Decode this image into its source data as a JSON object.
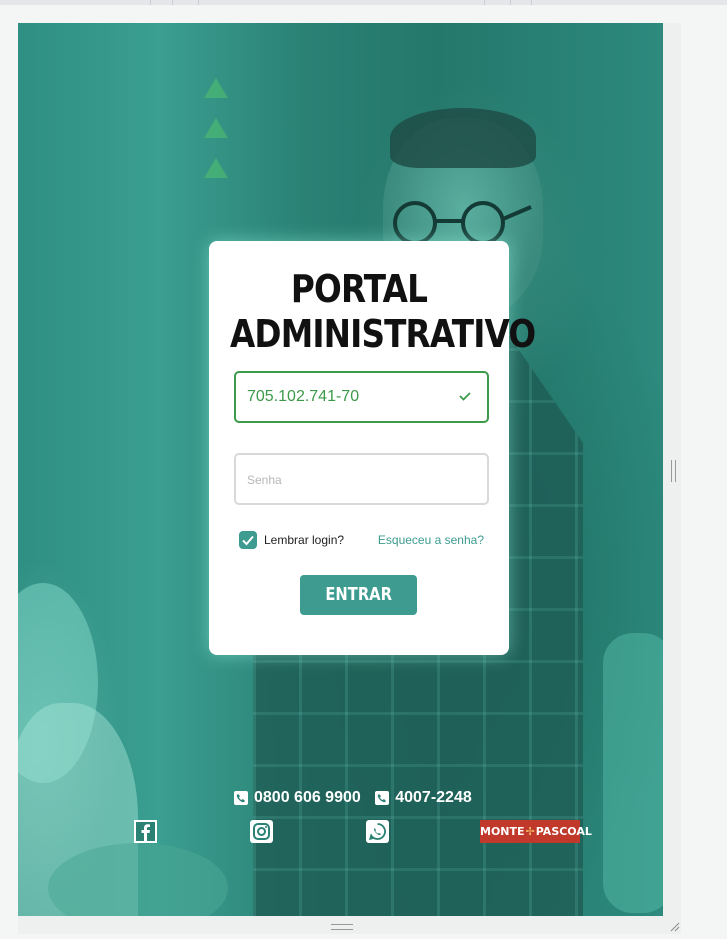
{
  "card": {
    "title_line1": "PORTAL",
    "title_line2": "ADMINISTRATIVO",
    "login_value": "705.102.741-70",
    "password_placeholder": "Senha",
    "remember_label": "Lembrar login?",
    "remember_checked": true,
    "forgot_label": "Esqueceu a senha?",
    "submit_label": "ENTRAR"
  },
  "footer": {
    "phone1": "0800 606 9900",
    "phone2": "4007-2248",
    "social": [
      "facebook-icon",
      "instagram-icon",
      "whatsapp-icon"
    ],
    "logo_left": "MONTE",
    "logo_right": "PASCOAL"
  },
  "colors": {
    "accent": "#3d9b8f",
    "valid_green": "#3c9a4a",
    "logo_red": "#c0392b"
  }
}
